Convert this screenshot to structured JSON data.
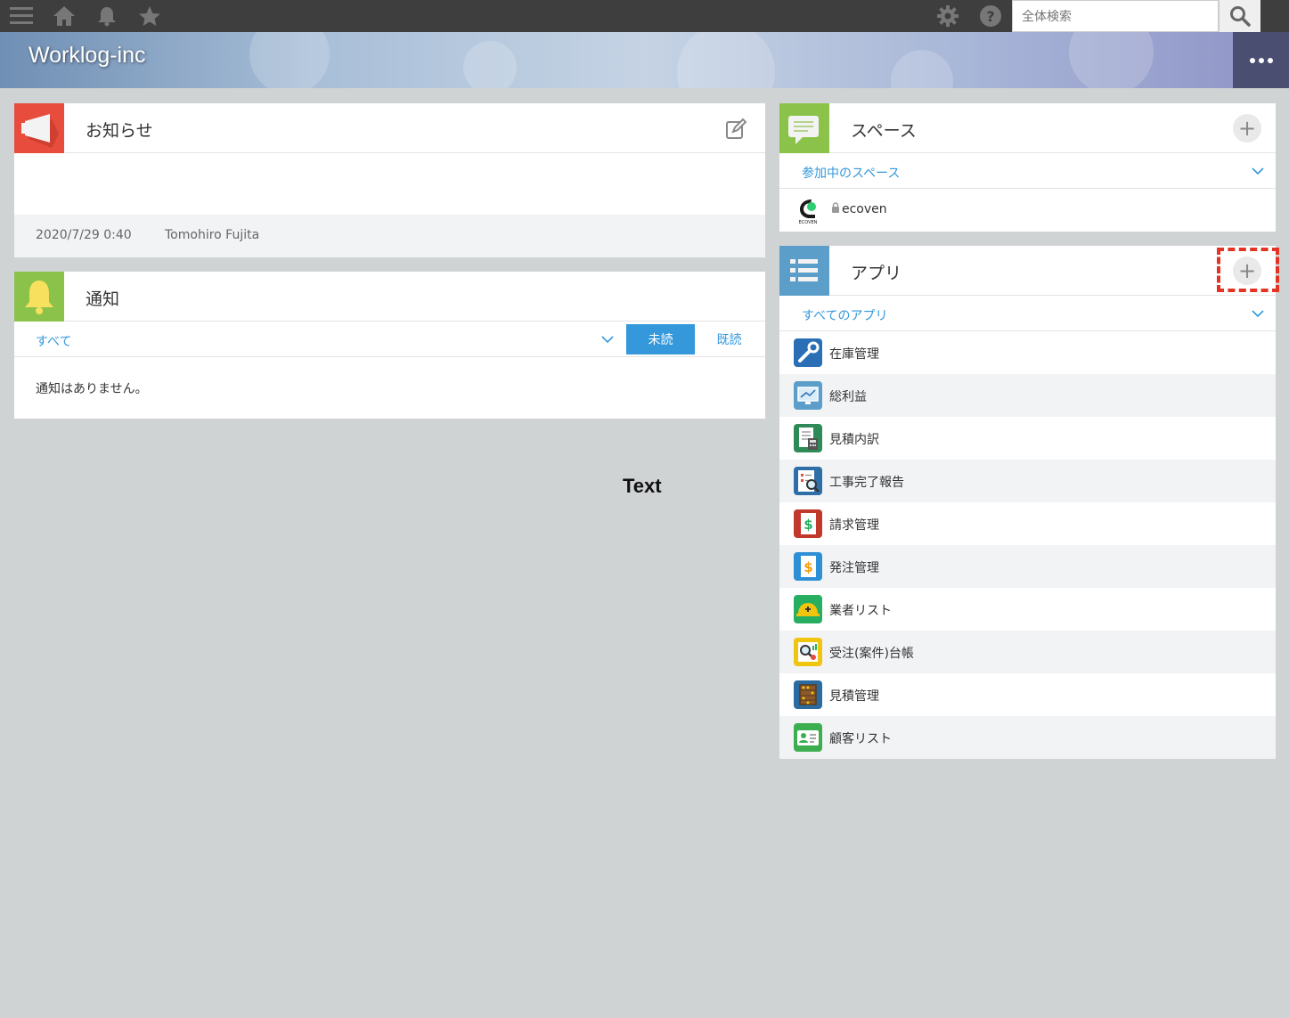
{
  "topbar": {
    "icons": [
      "menu-icon",
      "home-icon",
      "bell-icon",
      "star-icon",
      "gear-icon",
      "help-icon",
      "search-icon"
    ],
    "search_placeholder": "全体検索"
  },
  "header": {
    "title": "Worklog-inc"
  },
  "announcement": {
    "title": "お知らせ",
    "date": "2020/7/29 0:40",
    "author": "Tomohiro Fujita"
  },
  "notifications": {
    "title": "通知",
    "filter": "すべて",
    "unread_tab": "未読",
    "read_tab": "既読",
    "empty_message": "通知はありません。"
  },
  "spaces": {
    "title": "スペース",
    "filter": "参加中のスペース",
    "items": [
      {
        "name": "ecoven",
        "locked": true
      }
    ]
  },
  "apps": {
    "title": "アプリ",
    "filter": "すべてのアプリ",
    "items": [
      {
        "name": "在庫管理",
        "color": "#2a6fb5"
      },
      {
        "name": "総利益",
        "color": "#5b9ec9"
      },
      {
        "name": "見積内訳",
        "color": "#2e8b57"
      },
      {
        "name": "工事完了報告",
        "color": "#2f6fa8"
      },
      {
        "name": "請求管理",
        "color": "#c0392b"
      },
      {
        "name": "発注管理",
        "color": "#2d8fd5"
      },
      {
        "name": "業者リスト",
        "color": "#27ae60"
      },
      {
        "name": "受注(案件)台帳",
        "color": "#f1c40f"
      },
      {
        "name": "見積管理",
        "color": "#2c6ba0"
      },
      {
        "name": "顧客リスト",
        "color": "#3cae4f"
      }
    ]
  },
  "overlay_text": "Text"
}
